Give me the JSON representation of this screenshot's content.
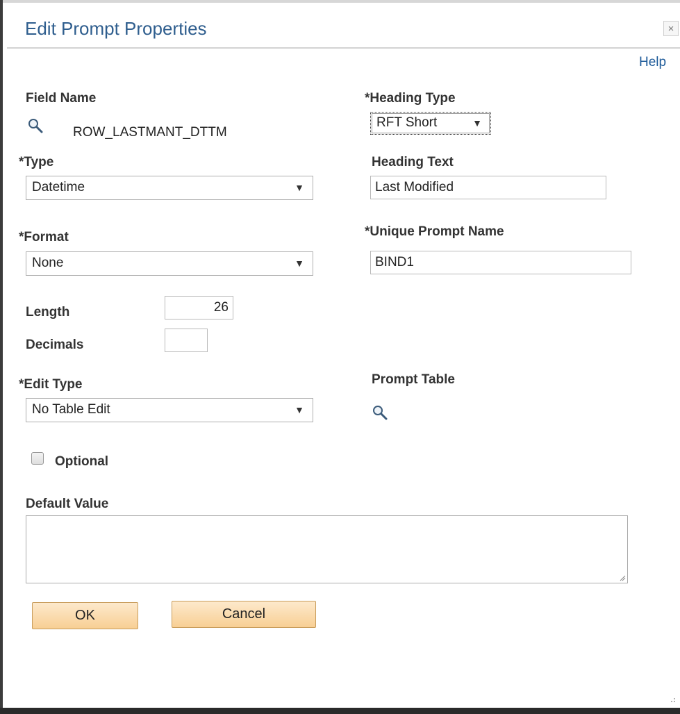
{
  "dialog": {
    "title": "Edit Prompt Properties",
    "close_glyph": "×",
    "help_label": "Help"
  },
  "form": {
    "field_name": {
      "label": "Field Name",
      "value": "ROW_LASTMANT_DTTM",
      "icon": "magnifier-icon"
    },
    "heading_type": {
      "label": "*Heading Type",
      "value": "RFT Short"
    },
    "type": {
      "label": "*Type",
      "value": "Datetime"
    },
    "heading_text": {
      "label": "Heading Text",
      "value": "Last Modified"
    },
    "format": {
      "label": "*Format",
      "value": "None"
    },
    "unique_prompt_name": {
      "label": "*Unique Prompt Name",
      "value": "BIND1"
    },
    "length": {
      "label": "Length",
      "value": "26"
    },
    "decimals": {
      "label": "Decimals",
      "value": ""
    },
    "edit_type": {
      "label": "*Edit Type",
      "value": "No Table Edit"
    },
    "prompt_table": {
      "label": "Prompt Table",
      "icon": "magnifier-icon"
    },
    "optional": {
      "label": "Optional",
      "checked": false
    },
    "default_value": {
      "label": "Default Value",
      "value": ""
    }
  },
  "buttons": {
    "ok_label": "OK",
    "cancel_label": "Cancel"
  },
  "colors": {
    "title": "#2f5e8e",
    "link": "#1d5a99",
    "button_fill": "#f8cf94",
    "button_border": "#c89c5a"
  }
}
